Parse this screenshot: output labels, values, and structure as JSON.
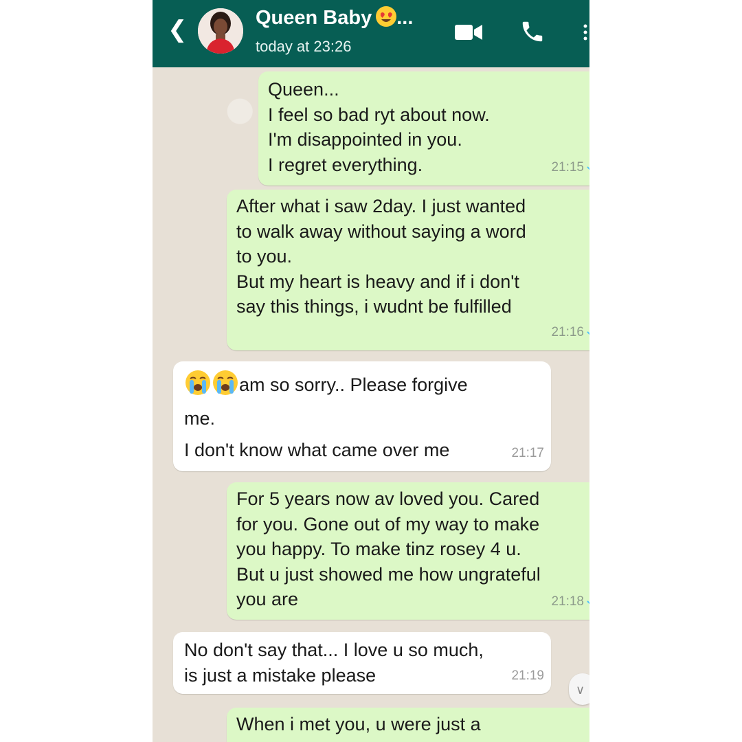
{
  "header": {
    "back_icon": "chevron-left-icon",
    "contact_name": "Queen Baby",
    "name_emoji": "heart-eyes-emoji",
    "name_ellipsis": "...",
    "last_seen": "today at 23:26",
    "actions": [
      "video-call-icon",
      "voice-call-icon",
      "more-options-icon"
    ],
    "header_color": "#075e54"
  },
  "messages": [
    {
      "direction": "outgoing",
      "text": "Queen...\nI feel so bad ryt about now.\nI'm disappointed in you.\nI regret everything.",
      "time": "21:15",
      "status": "read-ticks"
    },
    {
      "direction": "outgoing",
      "text": "After what i saw 2day. I just wanted\nto walk away without saying a word\nto you.\nBut my heart is heavy and if i don't\nsay this things, i wudnt be fulfilled",
      "time": "21:16",
      "status": "read-ticks"
    },
    {
      "direction": "incoming",
      "emoji": "loudly-crying-face-emoji",
      "text_first": "am so sorry..  Please forgive",
      "text_rest": "me.\nI don't know what came over me",
      "time": "21:17"
    },
    {
      "direction": "outgoing",
      "text": "For 5 years now av loved you. Cared\nfor you. Gone out of my way to make\nyou happy. To make tinz rosey 4 u.\nBut u just showed me how ungrateful\nyou are",
      "time": "21:18",
      "status": "read-ticks"
    },
    {
      "direction": "incoming",
      "text": "No don't say that...  I love u so much,\nis just a mistake please",
      "time": "21:19"
    },
    {
      "direction": "outgoing",
      "text": "When i met you, u were just a",
      "time": ""
    }
  ],
  "scroll_button_icon": "chevron-down-icon",
  "colors": {
    "outgoing_bubble": "#dcf8c6",
    "incoming_bubble": "#ffffff",
    "wallpaper": "#e7e0d6",
    "read_ticks": "#4fc3f7"
  }
}
